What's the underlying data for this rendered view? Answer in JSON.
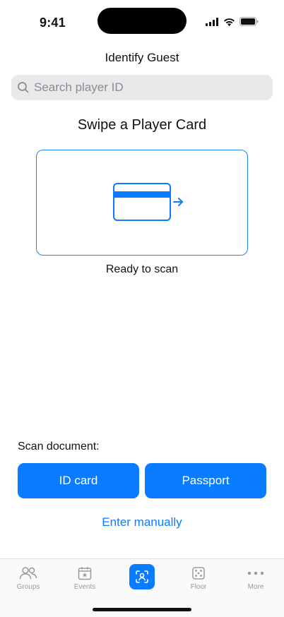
{
  "status_bar": {
    "time": "9:41"
  },
  "header": {
    "title": "Identify Guest"
  },
  "search": {
    "placeholder": "Search player ID",
    "value": ""
  },
  "swipe": {
    "title": "Swipe a Player Card",
    "status": "Ready to scan"
  },
  "scan_document": {
    "label": "Scan document:",
    "buttons": [
      {
        "label": "ID card"
      },
      {
        "label": "Passport"
      }
    ],
    "manual_link": "Enter manually"
  },
  "tab_bar": {
    "items": [
      {
        "label": "Groups",
        "icon": "people-icon"
      },
      {
        "label": "Events",
        "icon": "calendar-star-icon"
      },
      {
        "label": "",
        "icon": "scan-face-icon",
        "active": true
      },
      {
        "label": "Floor",
        "icon": "dice-icon"
      },
      {
        "label": "More",
        "icon": "ellipsis-icon"
      }
    ]
  },
  "colors": {
    "accent": "#0a7cff",
    "border": "#2383f2",
    "tab_inactive": "#9a9a9e"
  }
}
